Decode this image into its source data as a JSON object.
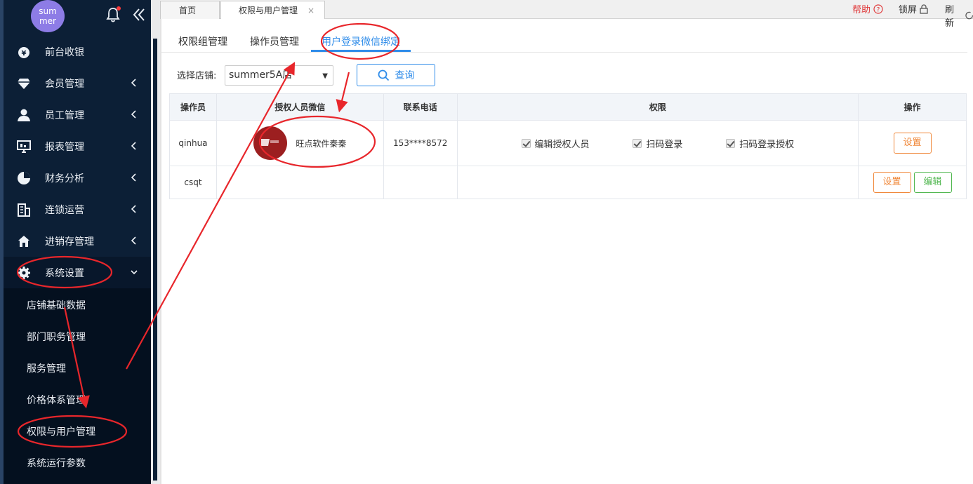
{
  "sidebar": {
    "avatar_text": "sum mer",
    "menu": [
      {
        "label": "前台收银",
        "icon": "cash-register-icon"
      },
      {
        "label": "会员管理",
        "icon": "diamond-icon"
      },
      {
        "label": "员工管理",
        "icon": "person-icon"
      },
      {
        "label": "报表管理",
        "icon": "monitor-icon"
      },
      {
        "label": "财务分析",
        "icon": "pie-chart-icon"
      },
      {
        "label": "连锁运营",
        "icon": "building-icon"
      },
      {
        "label": "进销存管理",
        "icon": "house-icon"
      },
      {
        "label": "系统设置",
        "icon": "gear-icon",
        "expanded": true
      }
    ],
    "submenu": [
      "店铺基础数据",
      "部门职务管理",
      "服务管理",
      "价格体系管理",
      "权限与用户管理",
      "系统运行参数"
    ]
  },
  "tabs": {
    "home": "首页",
    "active": "权限与用户管理",
    "close": "×"
  },
  "toolbar": {
    "help": "帮助",
    "lock": "锁屏",
    "refresh": "刷新"
  },
  "subtabs": [
    "权限组管理",
    "操作员管理",
    "用户登录微信绑定"
  ],
  "filter": {
    "store_label": "选择店铺:",
    "store_value": "summer5A店",
    "query_label": "查询"
  },
  "table": {
    "headers": [
      "操作员",
      "授权人员微信",
      "联系电话",
      "权限",
      "操作"
    ],
    "rows": [
      {
        "operator": "qinhua",
        "wechat_name": "旺点软件秦秦",
        "phone": "153****8572",
        "permissions": [
          "编辑授权人员",
          "扫码登录",
          "扫码登录授权"
        ],
        "actions": [
          "设置"
        ]
      },
      {
        "operator": "csqt",
        "wechat_name": "",
        "phone": "",
        "permissions": [],
        "actions": [
          "设置",
          "编辑"
        ]
      }
    ]
  },
  "colors": {
    "sidebar_bg": "#0c1f36",
    "accent": "#2f8ce9",
    "annotation": "#e8262b",
    "set_button": "#f0883a",
    "edit_button": "#51b750"
  }
}
